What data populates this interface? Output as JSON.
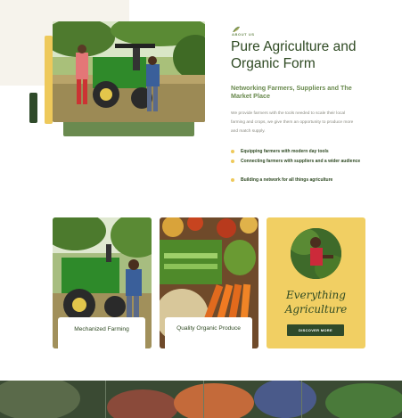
{
  "about": {
    "eyebrow": "ABOUT US",
    "title": "Pure Agriculture and Organic Form",
    "subtitle": "Networking Farmers, Suppliers and The Market Place",
    "description": "We provide farmers with the tools needed to scale their local farming and crops, we give them an opportunity to produce more and match supply.",
    "bullets": [
      "Equipping farmers with modern day tools",
      "Connecting farmers with suppliers and a wider audience",
      "Building a network for all things agriculture"
    ]
  },
  "cards": [
    {
      "label": "Mechanized Farming"
    },
    {
      "label": "Quality Organic Produce"
    },
    {
      "script_line1": "Everything",
      "script_line2": "Agriculture",
      "button_label": "DISCOVER MORE"
    }
  ],
  "colors": {
    "dark_green": "#2f4a23",
    "accent_green": "#6a8a4f",
    "accent_yellow": "#eec95b",
    "beige": "#f6f3ec"
  }
}
